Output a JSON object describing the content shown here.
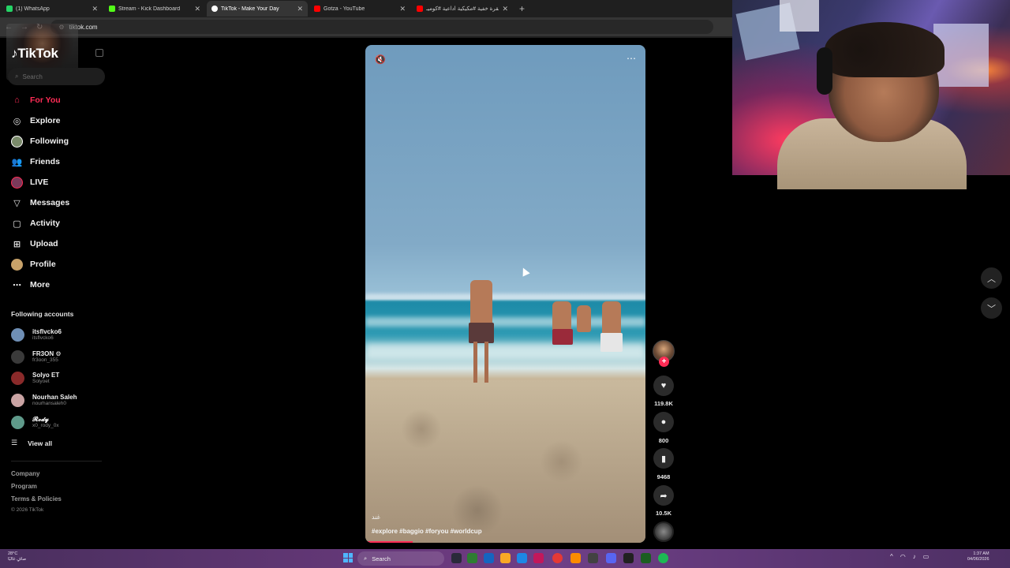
{
  "browser": {
    "tabs": [
      {
        "label": "(1) WhatsApp",
        "favicon_color": "#25d366",
        "active": false
      },
      {
        "label": "Stream - Kick Dashboard",
        "favicon_color": "#53fc18",
        "active": false
      },
      {
        "label": "TikTok - Make Your Day",
        "favicon_color": "#ffffff",
        "active": true
      },
      {
        "label": "Gotza - YouTube",
        "favicon_color": "#ff0000",
        "active": false
      },
      {
        "label": "العقرة خفية #مكيكية اداعية #كوميـ...",
        "favicon_color": "#ff0000",
        "active": false
      }
    ],
    "new_tab": "+",
    "address": "tiktok.com"
  },
  "sidebar": {
    "logo": "TikTok",
    "search_placeholder": "Search",
    "nav": [
      {
        "label": "For You",
        "icon": "home-icon",
        "selected": true
      },
      {
        "label": "Explore",
        "icon": "compass-icon",
        "selected": false
      },
      {
        "label": "Following",
        "icon": "following-avatar-icon",
        "selected": false
      },
      {
        "label": "Friends",
        "icon": "friends-icon",
        "selected": false
      },
      {
        "label": "LIVE",
        "icon": "live-icon",
        "selected": false
      },
      {
        "label": "Messages",
        "icon": "messages-icon",
        "selected": false
      },
      {
        "label": "Activity",
        "icon": "activity-icon",
        "selected": false
      },
      {
        "label": "Upload",
        "icon": "upload-icon",
        "selected": false
      },
      {
        "label": "Profile",
        "icon": "profile-avatar-icon",
        "selected": false
      },
      {
        "label": "More",
        "icon": "more-icon",
        "selected": false
      }
    ],
    "following_title": "Following accounts",
    "accounts": [
      {
        "name": "itsflvcko6",
        "handle": "itsflvcko6",
        "color": "#6f8fb5"
      },
      {
        "name": "FR3ON ⚙",
        "handle": "fr3oon_355",
        "color": "#3a3a3a"
      },
      {
        "name": "Solyo ET",
        "handle": "Solyoet",
        "color": "#8a2a2a"
      },
      {
        "name": "Nourhan Saleh",
        "handle": "nourhansaleh0",
        "color": "#c9a3a3"
      },
      {
        "name": "𝓡𝓸𝓭𝔂",
        "handle": "x0_rody_0x",
        "color": "#5f9a8a"
      }
    ],
    "view_all": "View all",
    "footer_links": [
      "Company",
      "Program",
      "Terms & Policies"
    ],
    "copyright": "© 2026 TikTok"
  },
  "video": {
    "handle": "غند",
    "tags": "#explore #baggio #foryou #worldcup",
    "progress": 0.17
  },
  "actions": {
    "likes": "119.8K",
    "comments": "800",
    "saves": "9468",
    "shares": "10.5K",
    "follow_symbol": "+"
  },
  "taskbar": {
    "weather_temp": "28°C",
    "weather_desc": "صافٍ غالبًا",
    "search_label": "Search",
    "time": "1:37 AM",
    "date": "04/06/2026"
  },
  "colors": {
    "accent": "#fe2c55",
    "sidebar_bg": "#000000",
    "taskbar": "#6b3a7e"
  }
}
